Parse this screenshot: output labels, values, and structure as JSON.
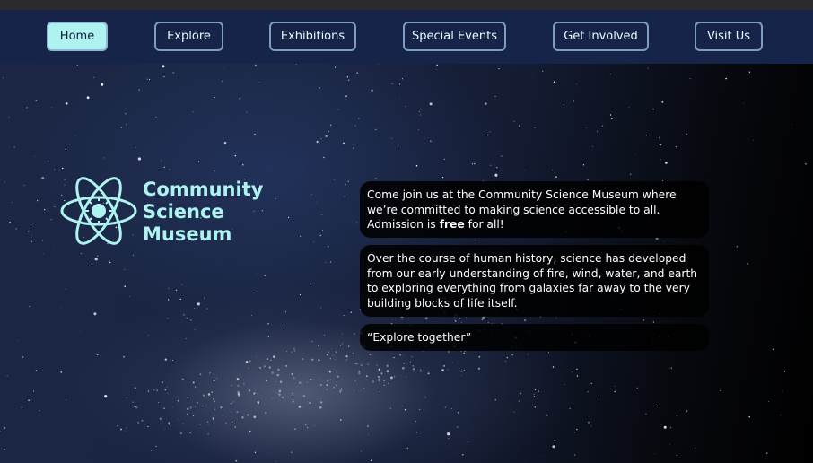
{
  "nav": {
    "items": [
      {
        "label": "Home",
        "active": true
      },
      {
        "label": "Explore"
      },
      {
        "label": "Exhibitions"
      },
      {
        "label": "Special Events"
      },
      {
        "label": "Get Involved"
      },
      {
        "label": "Visit Us"
      }
    ]
  },
  "logo": {
    "icon": "atom-sun-icon",
    "line1": "Community",
    "line2": "Science",
    "line3": "Museum"
  },
  "cards": {
    "welcome": {
      "line1": "Come join us at the Community Science Museum where we’re committed to making science accessible to all.",
      "admission_prefix": "Admission is ",
      "admission_bold": "free",
      "admission_suffix": " for all!"
    },
    "history": "Over the course of human history, science has developed from our early understanding of fire, wind, water, and earth to exploring everything from galaxies far away to the very building blocks of life itself.",
    "motto": "“Explore together”"
  },
  "colors": {
    "accent": "#aef3f0",
    "nav_background": "#16244a",
    "nav_border": "#7b9fc0"
  }
}
